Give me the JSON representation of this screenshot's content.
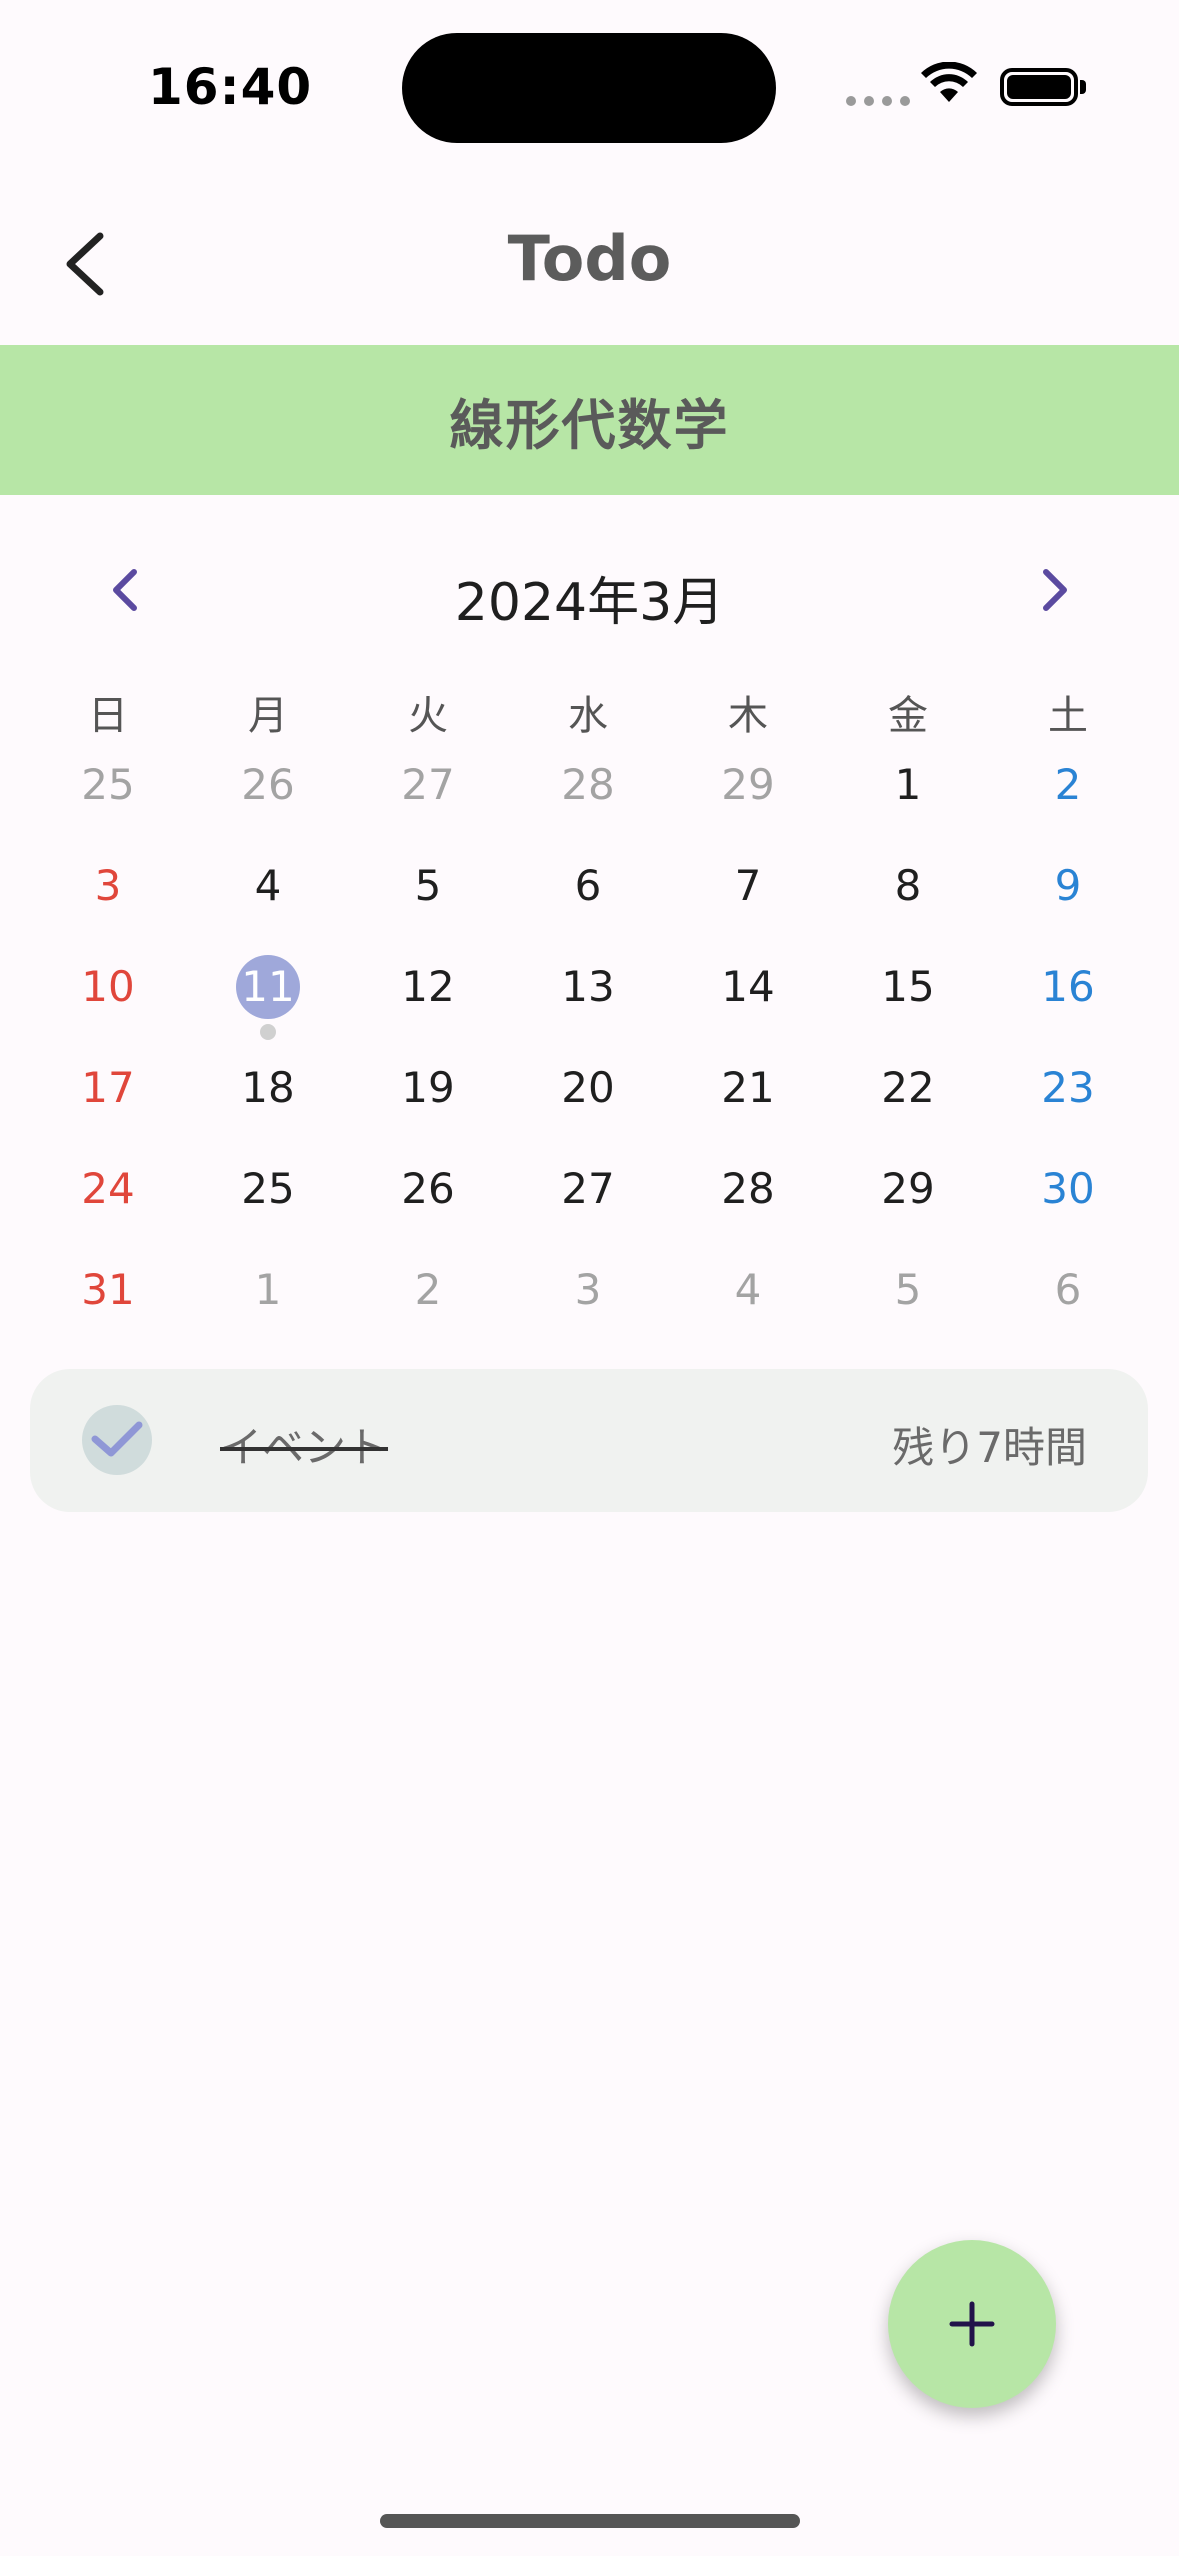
{
  "status_bar": {
    "time": "16:40"
  },
  "app_bar": {
    "title": "Todo",
    "back_icon": "chevron-left-icon"
  },
  "banner": {
    "subject": "線形代数学",
    "color": "#b7e6a6"
  },
  "calendar": {
    "month_label": "2024年3月",
    "weekdays": [
      "日",
      "月",
      "火",
      "水",
      "木",
      "金",
      "土"
    ],
    "weeks": [
      [
        {
          "d": "25",
          "t": "out"
        },
        {
          "d": "26",
          "t": "out"
        },
        {
          "d": "27",
          "t": "out"
        },
        {
          "d": "28",
          "t": "out"
        },
        {
          "d": "29",
          "t": "out"
        },
        {
          "d": "1",
          "t": "normal"
        },
        {
          "d": "2",
          "t": "sat"
        }
      ],
      [
        {
          "d": "3",
          "t": "sun"
        },
        {
          "d": "4",
          "t": "normal"
        },
        {
          "d": "5",
          "t": "normal"
        },
        {
          "d": "6",
          "t": "normal"
        },
        {
          "d": "7",
          "t": "normal"
        },
        {
          "d": "8",
          "t": "normal"
        },
        {
          "d": "9",
          "t": "sat"
        }
      ],
      [
        {
          "d": "10",
          "t": "sun"
        },
        {
          "d": "11",
          "t": "normal",
          "selected": true,
          "event": true
        },
        {
          "d": "12",
          "t": "normal"
        },
        {
          "d": "13",
          "t": "normal"
        },
        {
          "d": "14",
          "t": "normal"
        },
        {
          "d": "15",
          "t": "normal"
        },
        {
          "d": "16",
          "t": "sat"
        }
      ],
      [
        {
          "d": "17",
          "t": "sun"
        },
        {
          "d": "18",
          "t": "normal"
        },
        {
          "d": "19",
          "t": "normal"
        },
        {
          "d": "20",
          "t": "normal"
        },
        {
          "d": "21",
          "t": "normal"
        },
        {
          "d": "22",
          "t": "normal"
        },
        {
          "d": "23",
          "t": "sat"
        }
      ],
      [
        {
          "d": "24",
          "t": "sun"
        },
        {
          "d": "25",
          "t": "normal"
        },
        {
          "d": "26",
          "t": "normal"
        },
        {
          "d": "27",
          "t": "normal"
        },
        {
          "d": "28",
          "t": "normal"
        },
        {
          "d": "29",
          "t": "normal"
        },
        {
          "d": "30",
          "t": "sat"
        }
      ],
      [
        {
          "d": "31",
          "t": "sun"
        },
        {
          "d": "1",
          "t": "out"
        },
        {
          "d": "2",
          "t": "out"
        },
        {
          "d": "3",
          "t": "out"
        },
        {
          "d": "4",
          "t": "out"
        },
        {
          "d": "5",
          "t": "out"
        },
        {
          "d": "6",
          "t": "out"
        }
      ]
    ],
    "colors": {
      "sunday": "#e0463b",
      "saturday": "#2a83d4",
      "selected": "#9fa8da"
    }
  },
  "todos": [
    {
      "label": "イベント",
      "remaining": "残り7時間",
      "done": true
    }
  ],
  "fab": {
    "icon": "plus-icon"
  }
}
